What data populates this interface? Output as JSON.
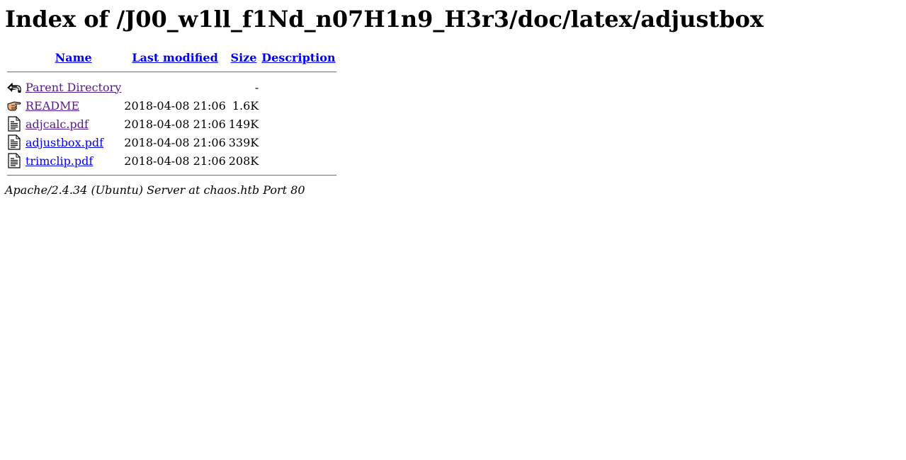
{
  "page": {
    "title": "Index of /J00_w1ll_f1Nd_n07H1n9_H3r3/doc/latex/adjustbox"
  },
  "table": {
    "headers": {
      "name": "Name",
      "last_modified": "Last modified",
      "size": "Size",
      "description": "Description"
    },
    "rows": [
      {
        "icon": "back-arrow-icon",
        "name": "Parent Directory",
        "last_modified": "",
        "size": "-",
        "description": "",
        "visited": true
      },
      {
        "icon": "hand-pointing-icon",
        "name": "README",
        "last_modified": "2018-04-08 21:06",
        "size": "1.6K",
        "description": "",
        "visited": true
      },
      {
        "icon": "text-document-icon",
        "name": "adjcalc.pdf",
        "last_modified": "2018-04-08 21:06",
        "size": "149K",
        "description": "",
        "visited": true
      },
      {
        "icon": "text-document-icon",
        "name": "adjustbox.pdf",
        "last_modified": "2018-04-08 21:06",
        "size": "339K",
        "description": "",
        "visited": false
      },
      {
        "icon": "text-document-icon",
        "name": "trimclip.pdf",
        "last_modified": "2018-04-08 21:06",
        "size": "208K",
        "description": "",
        "visited": false
      }
    ]
  },
  "footer": {
    "server_signature": "Apache/2.4.34 (Ubuntu) Server at chaos.htb Port 80"
  },
  "colors": {
    "link": "#0000ee",
    "visited": "#551a8b"
  }
}
